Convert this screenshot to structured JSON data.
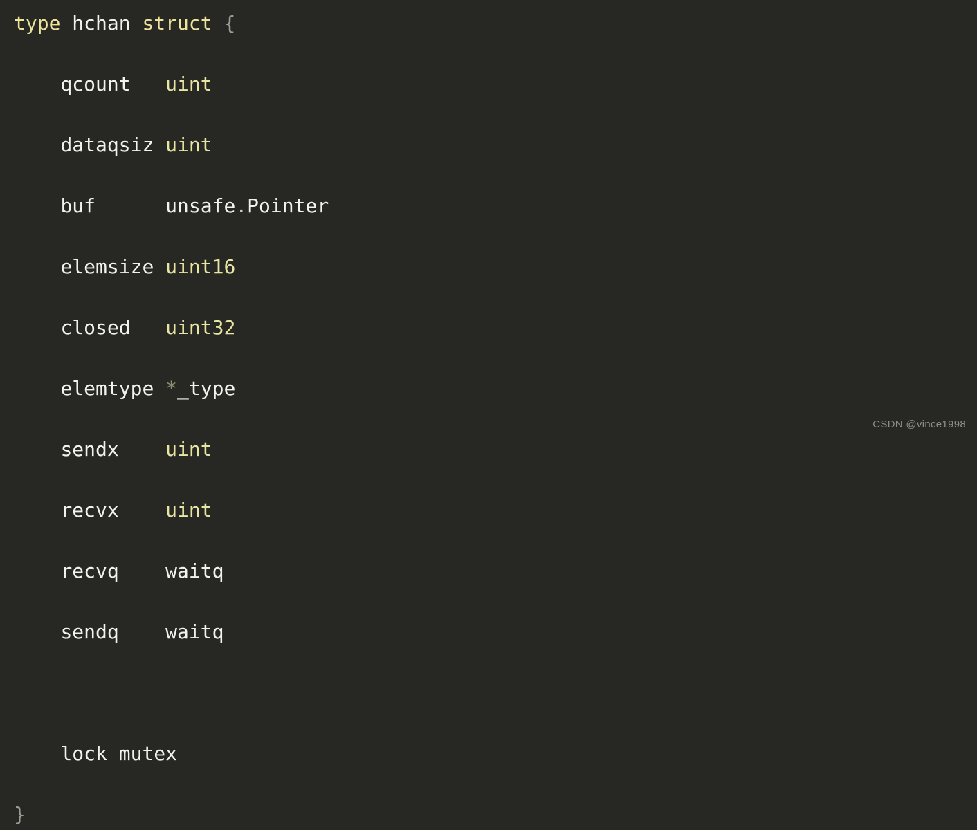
{
  "document": {
    "kind": "code-snippet",
    "language": "go",
    "theme": {
      "background": "#272824",
      "foreground": "#F2F2EE",
      "keyword": "#EDE39B",
      "type": "#E9E6A3",
      "punctuation": "#9C9C96",
      "operator": "#8A8F70",
      "watermark": "#8E8E8A"
    }
  },
  "code": {
    "lines": [
      {
        "id": "line-1",
        "indent": "",
        "tokens": [
          {
            "text": "type",
            "kind": "keyword"
          },
          {
            "text": " ",
            "kind": "plain"
          },
          {
            "text": "hchan",
            "kind": "ident"
          },
          {
            "text": " ",
            "kind": "plain"
          },
          {
            "text": "struct",
            "kind": "keyword"
          },
          {
            "text": " ",
            "kind": "plain"
          },
          {
            "text": "{",
            "kind": "punct"
          }
        ]
      },
      {
        "id": "line-2",
        "indent": "    ",
        "tokens": [
          {
            "text": "qcount   ",
            "kind": "field"
          },
          {
            "text": "uint",
            "kind": "type"
          }
        ]
      },
      {
        "id": "line-3",
        "indent": "    ",
        "tokens": [
          {
            "text": "dataqsiz ",
            "kind": "field"
          },
          {
            "text": "uint",
            "kind": "type"
          }
        ]
      },
      {
        "id": "line-4",
        "indent": "    ",
        "tokens": [
          {
            "text": "buf      ",
            "kind": "field"
          },
          {
            "text": "unsafe",
            "kind": "plain"
          },
          {
            "text": ".",
            "kind": "dot"
          },
          {
            "text": "Pointer",
            "kind": "plain"
          }
        ]
      },
      {
        "id": "line-5",
        "indent": "    ",
        "tokens": [
          {
            "text": "elemsize ",
            "kind": "field"
          },
          {
            "text": "uint16",
            "kind": "type"
          }
        ]
      },
      {
        "id": "line-6",
        "indent": "    ",
        "tokens": [
          {
            "text": "closed   ",
            "kind": "field"
          },
          {
            "text": "uint32",
            "kind": "type"
          }
        ]
      },
      {
        "id": "line-7",
        "indent": "    ",
        "tokens": [
          {
            "text": "elemtype ",
            "kind": "field"
          },
          {
            "text": "*",
            "kind": "operator"
          },
          {
            "text": "_type",
            "kind": "plain"
          }
        ]
      },
      {
        "id": "line-8",
        "indent": "    ",
        "tokens": [
          {
            "text": "sendx    ",
            "kind": "field"
          },
          {
            "text": "uint",
            "kind": "type"
          }
        ]
      },
      {
        "id": "line-9",
        "indent": "    ",
        "tokens": [
          {
            "text": "recvx    ",
            "kind": "field"
          },
          {
            "text": "uint",
            "kind": "type"
          }
        ]
      },
      {
        "id": "line-10",
        "indent": "    ",
        "tokens": [
          {
            "text": "recvq    ",
            "kind": "field"
          },
          {
            "text": "waitq",
            "kind": "plain"
          }
        ]
      },
      {
        "id": "line-11",
        "indent": "    ",
        "tokens": [
          {
            "text": "sendq    ",
            "kind": "field"
          },
          {
            "text": "waitq",
            "kind": "plain"
          }
        ]
      },
      {
        "id": "line-12",
        "indent": "",
        "tokens": []
      },
      {
        "id": "line-13",
        "indent": "    ",
        "tokens": [
          {
            "text": "lock",
            "kind": "plain"
          },
          {
            "text": " ",
            "kind": "plain"
          },
          {
            "text": "mutex",
            "kind": "plain"
          }
        ]
      },
      {
        "id": "line-14",
        "indent": "",
        "tokens": [
          {
            "text": "}",
            "kind": "punct"
          }
        ]
      }
    ],
    "plain_text": "type hchan struct {\n    qcount   uint\n    dataqsiz uint\n    buf      unsafe.Pointer\n    elemsize uint16\n    closed   uint32\n    elemtype *_type\n    sendx    uint\n    recvx    uint\n    recvq    waitq\n    sendq    waitq\n\n    lock mutex\n}"
  },
  "watermark": {
    "text": "CSDN @vince1998"
  }
}
